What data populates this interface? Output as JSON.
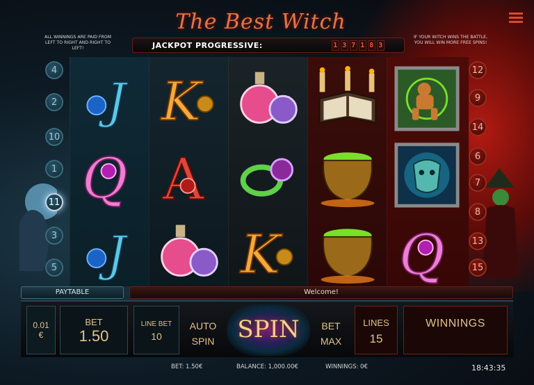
{
  "header": {
    "title": "The Best Witch",
    "jackpot_label": "JACKPOT PROGRESSIVE:",
    "jackpot_digits": [
      "1",
      "3",
      "7",
      "1",
      "8",
      "3"
    ],
    "note_left": "All winnings are paid from left to right and right to left!",
    "note_right": "If your witch wins the battle, you will win more free spins!"
  },
  "menu": {
    "icon": "menu-icon"
  },
  "paylines_left": [
    "4",
    "2",
    "10",
    "1",
    "11",
    "3",
    "5"
  ],
  "paylines_right": [
    "12",
    "9",
    "14",
    "6",
    "7",
    "8",
    "13",
    "15"
  ],
  "reels": [
    [
      "blue-J",
      "pink-Q",
      "blue-J"
    ],
    [
      "gold-K",
      "red-A",
      "potion-bottles"
    ],
    [
      "potion-bottles",
      "magic-ring",
      "gold-K"
    ],
    [
      "spell-book-candles",
      "bubbling-cauldron",
      "bubbling-cauldron"
    ],
    [
      "voodoo-doll",
      "blue-mask",
      "pink-Q"
    ]
  ],
  "infobar": {
    "paytable_label": "PAYTABLE",
    "message": "Welcome!"
  },
  "controls": {
    "coin_value": "0.01",
    "coin_currency": "€",
    "bet_label": "BET",
    "bet_value": "1.50",
    "line_bet_label": "LINE BET",
    "line_bet_value": "10",
    "auto_line1": "AUTO",
    "auto_line2": "SPIN",
    "spin_label": "SPIN",
    "betmax_line1": "BET",
    "betmax_line2": "MAX",
    "lines_label": "LINES",
    "lines_value": "15",
    "winnings_label": "WINNINGS"
  },
  "footer": {
    "bet": "BET: 1.50€",
    "balance": "BALANCE: 1,000.00€",
    "winnings": "WINNINGS: 0€",
    "clock": "18:43:35"
  },
  "colors": {
    "accent_red": "#d94b2e",
    "accent_teal": "#3f6f7e",
    "gold_text": "#e4c38a"
  }
}
